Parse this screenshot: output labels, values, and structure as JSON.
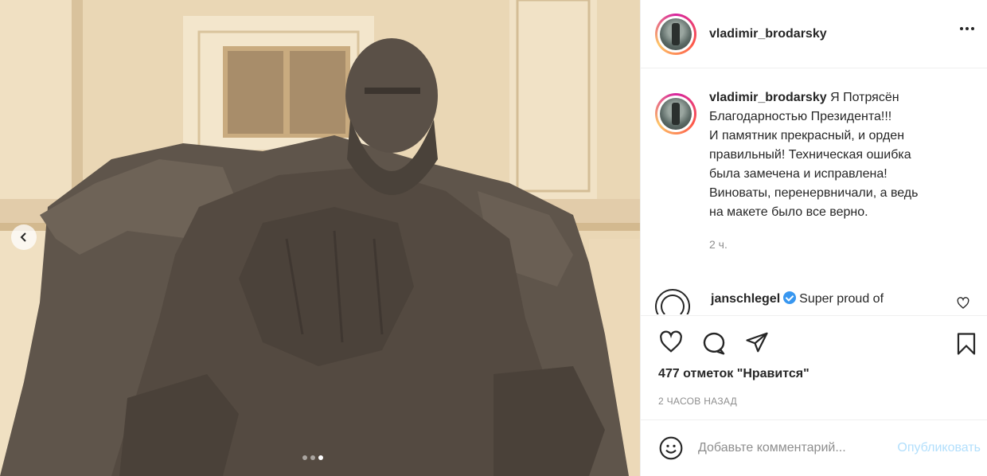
{
  "post": {
    "username": "vladimir_brodarsky",
    "more_icon": "more-horizontal-icon",
    "caption_text": "Я Потрясён\nБлагодарностью Президента!!!\nИ памятник прекрасный, и орден\nправильный! Техническая ошибка\nбыла замечена и исправлена!\nВиноваты, перенервничали, а ведь\nна макете было все верно.",
    "caption_time": "2 ч.",
    "carousel": {
      "dots": 3,
      "active_index": 2,
      "prev_icon": "chevron-left-icon"
    }
  },
  "comment": {
    "username": "janschlegel",
    "text": "Super proud of",
    "verified_icon": "verified-badge-icon",
    "like_icon": "heart-outline-icon"
  },
  "actions": {
    "like_icon": "heart-icon",
    "comment_icon": "comment-bubble-icon",
    "share_icon": "paper-plane-icon",
    "save_icon": "bookmark-icon",
    "likes_label": "477 отметок \"Нравится\"",
    "timestamp": "2 ЧАСОВ НАЗАД"
  },
  "add_comment": {
    "emoji_icon": "smiley-icon",
    "placeholder": "Добавьте комментарий...",
    "publish_label": "Опубликовать"
  },
  "colors": {
    "text": "#262626",
    "muted": "#8e8e8e",
    "link_disabled": "#b2dffc",
    "verified": "#3897f0"
  }
}
